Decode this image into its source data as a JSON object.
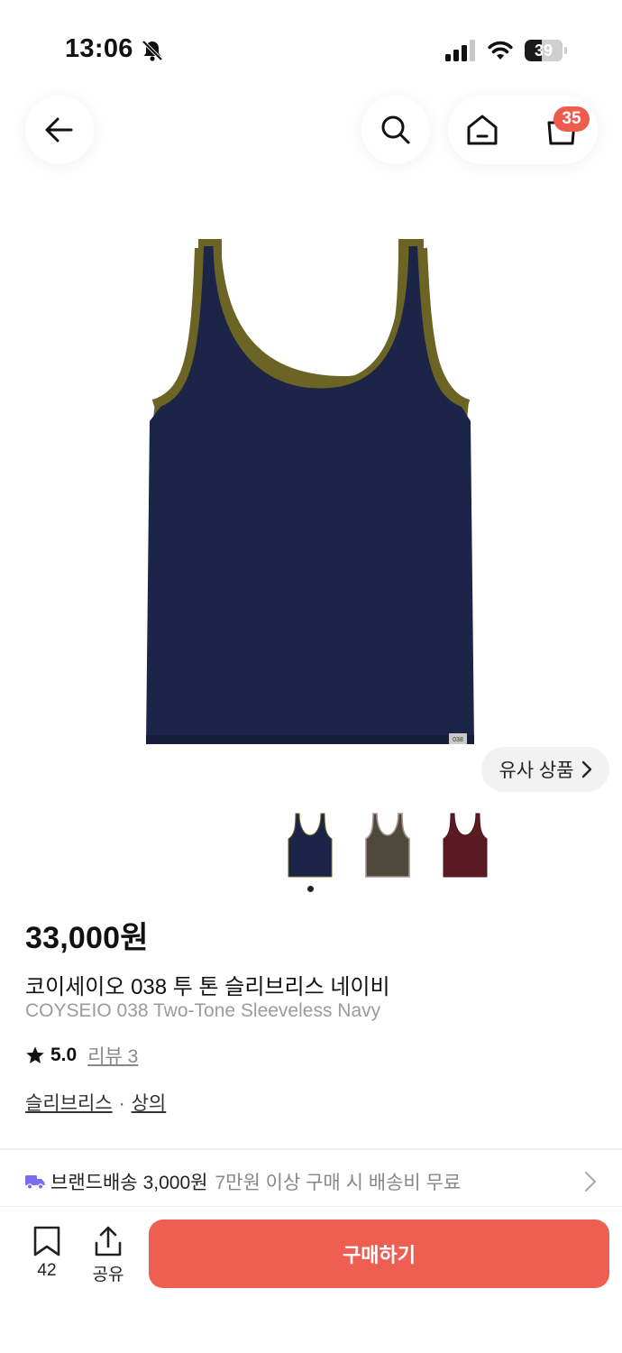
{
  "status_bar": {
    "time": "13:06",
    "battery": "39"
  },
  "nav": {
    "cart_count": "35"
  },
  "similar_button": {
    "label": "유사 상품"
  },
  "thumbnails": [
    {
      "name": "navy",
      "body_color": "#1c2447",
      "trim_color": "#1c2447"
    },
    {
      "name": "khaki",
      "body_color": "#4d4a3c",
      "trim_color": "#a78d8a"
    },
    {
      "name": "burgundy",
      "body_color": "#5a1a22",
      "trim_color": "#5a1a22"
    }
  ],
  "product": {
    "price": "33,000원",
    "name_ko": "코이세이오 038 투 톤 슬리브리스 네이비",
    "name_en": "COYSEIO 038 Two-Tone Sleeveless Navy",
    "rating": "5.0",
    "review_label": "리뷰 3",
    "label_tag": "038",
    "categories": [
      "슬리브리스",
      "상의"
    ],
    "category_sep": "·"
  },
  "shipping": {
    "label": "브랜드배송",
    "fee": "3,000원",
    "note": "7만원 이상 구매 시 배송비 무료"
  },
  "bottom_bar": {
    "bookmark_count": "42",
    "share_label": "공유",
    "buy_label": "구매하기"
  },
  "colors": {
    "accent": "#ee5f52",
    "badge": "#ee5c4c",
    "navy": "#1c2447",
    "trim_olive": "#6b6425",
    "shipping_icon": "#7b6cf0"
  }
}
